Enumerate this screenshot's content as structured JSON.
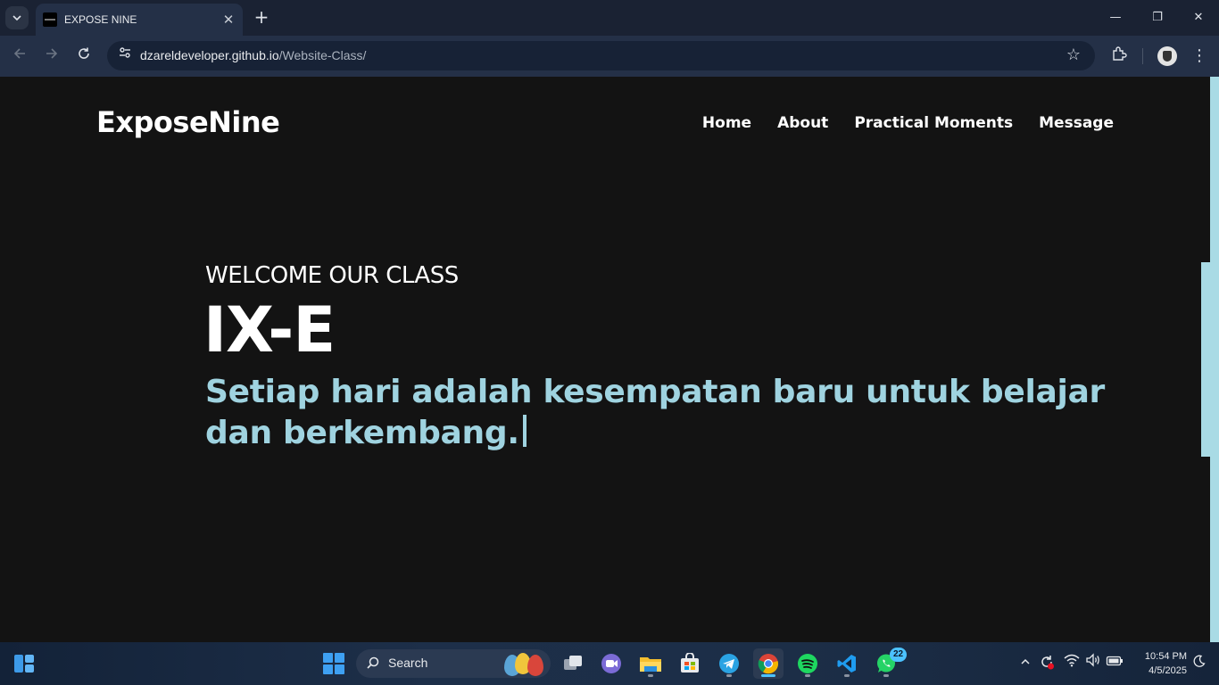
{
  "browser": {
    "tab_title": "EXPOSE NINE",
    "new_tab_symbol": "+",
    "url_host": "dzareldeveloper.github.io",
    "url_path": "/Website-Class/",
    "window_controls": {
      "minimize": "—",
      "maximize": "❐",
      "close": "✕"
    }
  },
  "site": {
    "logo": "ExposeNine",
    "nav": [
      "Home",
      "About",
      "Practical Moments",
      "Message"
    ],
    "welcome": "WELCOME OUR CLASS",
    "class_name": "IX-E",
    "tagline": "Setiap hari adalah kesempatan baru untuk belajar dan berkembang.",
    "accent_color": "#9fd3e0",
    "background_color": "#131313"
  },
  "taskbar": {
    "search_label": "Search",
    "apps": [
      "task-view",
      "zoom",
      "file-explorer",
      "microsoft-store",
      "telegram",
      "chrome",
      "spotify",
      "vscode",
      "whatsapp"
    ],
    "active_app": "chrome",
    "whatsapp_badge": "22",
    "clock": {
      "time": "10:54 PM",
      "date": "4/5/2025"
    }
  }
}
